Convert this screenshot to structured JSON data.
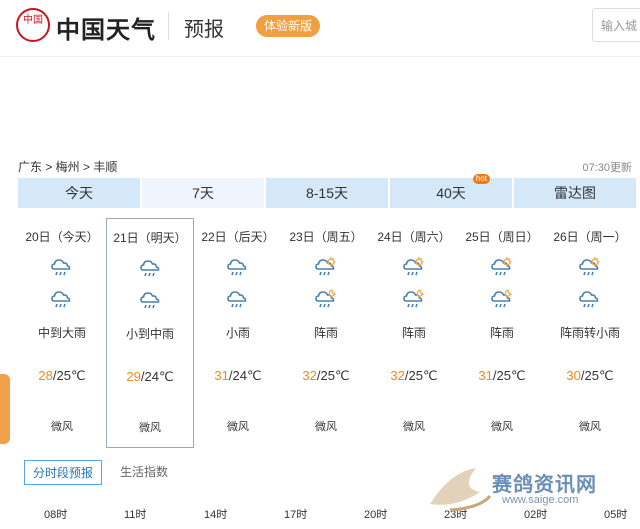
{
  "header": {
    "logo_seal_text": "中国",
    "logo_text": "中国天气",
    "section_title": "预报",
    "trial_button": "体验新版",
    "search_placeholder": "输入城"
  },
  "breadcrumb": "广东 > 梅州 > 丰顺",
  "update_time": "07:30更新",
  "tabs": [
    {
      "label": "今天",
      "active": false
    },
    {
      "label": "7天",
      "active": true
    },
    {
      "label": "8-15天",
      "active": false
    },
    {
      "label": "40天",
      "active": false,
      "badge": "hot"
    },
    {
      "label": "雷达图",
      "active": false
    }
  ],
  "days": [
    {
      "date": "20日（今天）",
      "icon1": "rain-icon",
      "icon2": "rain-icon",
      "desc": "中到大雨",
      "high": "28",
      "low": "/25℃",
      "wind": "微风"
    },
    {
      "date": "21日（明天）",
      "icon1": "rain-icon",
      "icon2": "rain-icon",
      "desc": "小到中雨",
      "high": "29",
      "low": "/24℃",
      "wind": "微风"
    },
    {
      "date": "22日（后天）",
      "icon1": "rain-icon",
      "icon2": "rain-icon",
      "desc": "小雨",
      "high": "31",
      "low": "/24℃",
      "wind": "微风"
    },
    {
      "date": "23日（周五）",
      "icon1": "sun-rain-icon",
      "icon2": "moon-rain-icon",
      "desc": "阵雨",
      "high": "32",
      "low": "/25℃",
      "wind": "微风"
    },
    {
      "date": "24日（周六）",
      "icon1": "sun-rain-icon",
      "icon2": "moon-rain-icon",
      "desc": "阵雨",
      "high": "32",
      "low": "/25℃",
      "wind": "微风"
    },
    {
      "date": "25日（周日）",
      "icon1": "sun-rain-icon",
      "icon2": "moon-rain-icon",
      "desc": "阵雨",
      "high": "31",
      "low": "/25℃",
      "wind": "微风"
    },
    {
      "date": "26日（周一）",
      "icon1": "sun-rain-icon",
      "icon2": "rain-icon",
      "desc": "阵雨转小雨",
      "high": "30",
      "low": "/25℃",
      "wind": "微风"
    }
  ],
  "sub_tabs": [
    {
      "label": "分时段预报",
      "active": true
    },
    {
      "label": "生活指数",
      "active": false
    }
  ],
  "hours": [
    "08时",
    "11时",
    "14时",
    "17时",
    "20时",
    "23时",
    "02时",
    "05时"
  ],
  "watermark": {
    "name": "赛鸽资讯网",
    "url": "www.saige.com"
  },
  "colors": {
    "accent": "#f08a24",
    "tab_bg": "#d4e8f8",
    "tab_active_bg": "#eef5fc",
    "logo_red": "#c8161d"
  }
}
